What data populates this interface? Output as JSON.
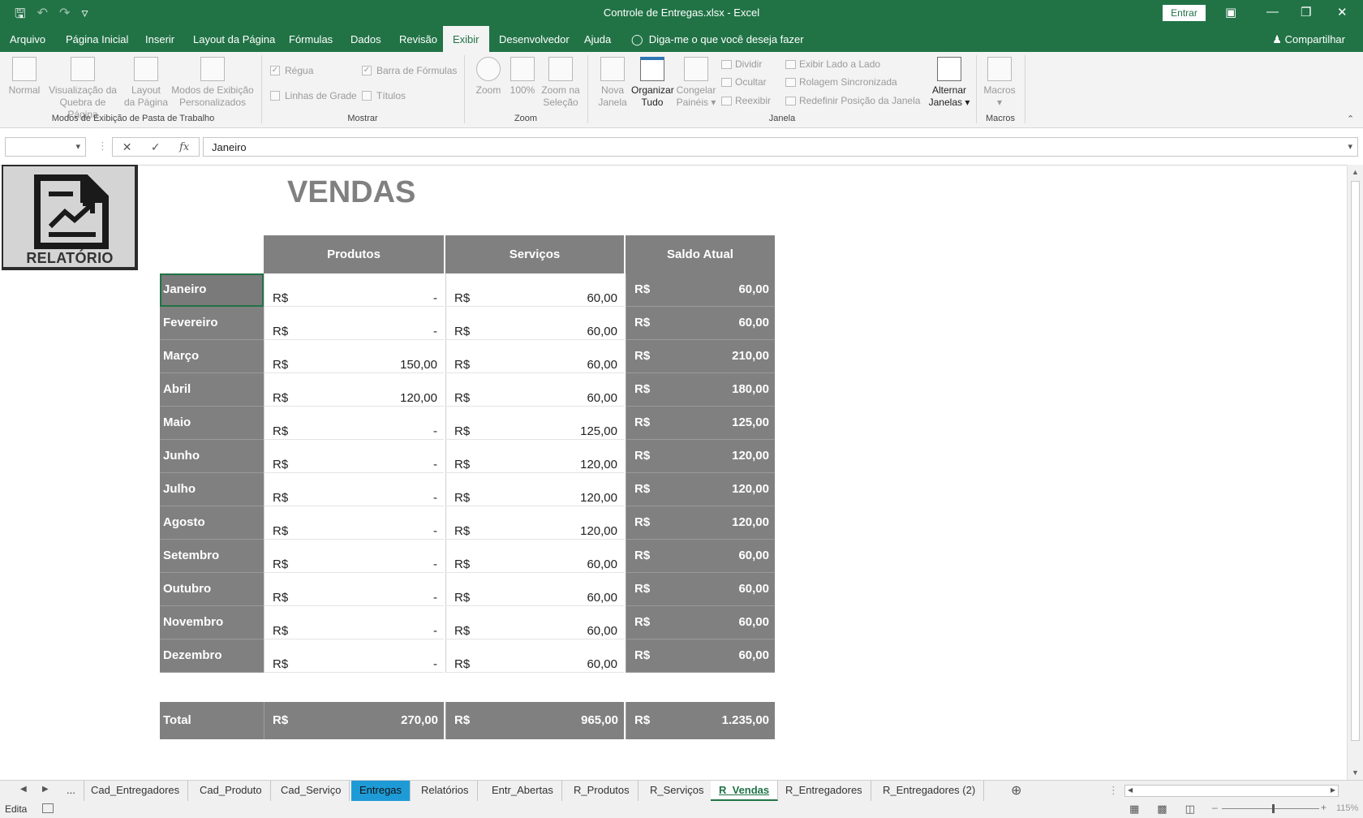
{
  "window": {
    "title": "Controle de Entregas.xlsx  -  Excel",
    "signin_label": "Entrar"
  },
  "ribbon_tabs": [
    "Arquivo",
    "Página Inicial",
    "Inserir",
    "Layout da Página",
    "Fórmulas",
    "Dados",
    "Revisão",
    "Exibir",
    "Desenvolvedor",
    "Ajuda"
  ],
  "active_tab": "Exibir",
  "tell_me": "Diga-me o que você deseja fazer",
  "share_label": "Compartilhar",
  "ribbon": {
    "views": {
      "normal": "Normal",
      "page_break_1": "Visualização da",
      "page_break_2": "Quebra de Página",
      "page_layout_1": "Layout",
      "page_layout_2": "da Página",
      "custom_1": "Modos de Exibição",
      "custom_2": "Personalizados",
      "group": "Modos de Exibição de Pasta de Trabalho"
    },
    "show": {
      "ruler": "Régua",
      "formula_bar": "Barra de Fórmulas",
      "gridlines": "Linhas de Grade",
      "headings": "Títulos",
      "group": "Mostrar"
    },
    "zoom": {
      "zoom": "Zoom",
      "hundred": "100%",
      "selection_1": "Zoom na",
      "selection_2": "Seleção",
      "group": "Zoom"
    },
    "window": {
      "new_1": "Nova",
      "new_2": "Janela",
      "arrange_1": "Organizar",
      "arrange_2": "Tudo",
      "freeze_1": "Congelar",
      "freeze_2": "Painéis",
      "split": "Dividir",
      "hide": "Ocultar",
      "unhide": "Reexibir",
      "side_by_side": "Exibir Lado a Lado",
      "sync_scroll": "Rolagem Sincronizada",
      "reset_pos": "Redefinir Posição da Janela",
      "switch_1": "Alternar",
      "switch_2": "Janelas",
      "group": "Janela"
    },
    "macros": {
      "macros": "Macros",
      "group": "Macros"
    }
  },
  "formula_bar": {
    "name_box": "",
    "fx": "fx",
    "content": "Janeiro"
  },
  "sheet": {
    "logo_label": "RELATÓRIO",
    "title": "VENDAS",
    "headers": [
      "Produtos",
      "Serviços",
      "Saldo Atual"
    ],
    "currency": "R$",
    "rows": [
      {
        "month": "Janeiro",
        "produtos": "-",
        "servicos": "60,00",
        "saldo": "60,00"
      },
      {
        "month": "Fevereiro",
        "produtos": "-",
        "servicos": "60,00",
        "saldo": "60,00"
      },
      {
        "month": "Março",
        "produtos": "150,00",
        "servicos": "60,00",
        "saldo": "210,00"
      },
      {
        "month": "Abril",
        "produtos": "120,00",
        "servicos": "60,00",
        "saldo": "180,00"
      },
      {
        "month": "Maio",
        "produtos": "-",
        "servicos": "125,00",
        "saldo": "125,00"
      },
      {
        "month": "Junho",
        "produtos": "-",
        "servicos": "120,00",
        "saldo": "120,00"
      },
      {
        "month": "Julho",
        "produtos": "-",
        "servicos": "120,00",
        "saldo": "120,00"
      },
      {
        "month": "Agosto",
        "produtos": "-",
        "servicos": "120,00",
        "saldo": "120,00"
      },
      {
        "month": "Setembro",
        "produtos": "-",
        "servicos": "60,00",
        "saldo": "60,00"
      },
      {
        "month": "Outubro",
        "produtos": "-",
        "servicos": "60,00",
        "saldo": "60,00"
      },
      {
        "month": "Novembro",
        "produtos": "-",
        "servicos": "60,00",
        "saldo": "60,00"
      },
      {
        "month": "Dezembro",
        "produtos": "-",
        "servicos": "60,00",
        "saldo": "60,00"
      }
    ],
    "total": {
      "label": "Total",
      "produtos": "270,00",
      "servicos": "965,00",
      "saldo": "1.235,00"
    }
  },
  "sheet_tabs": {
    "ellipsis": "...",
    "tabs": [
      "Cad_Entregadores",
      "Cad_Produto",
      "Cad_Serviço",
      "Entregas",
      "Relatórios",
      "Entr_Abertas",
      "R_Produtos",
      "R_Serviços",
      "R_Vendas",
      "R_Entregadores",
      "R_Entregadores (2)"
    ],
    "active": "R_Vendas",
    "highlighted": "Entregas"
  },
  "status": {
    "mode": "Edita",
    "zoom": "115%"
  },
  "colors": {
    "excel_green": "#217346",
    "header_gray": "#808080",
    "tab_highlight": "#1e9bd7"
  }
}
